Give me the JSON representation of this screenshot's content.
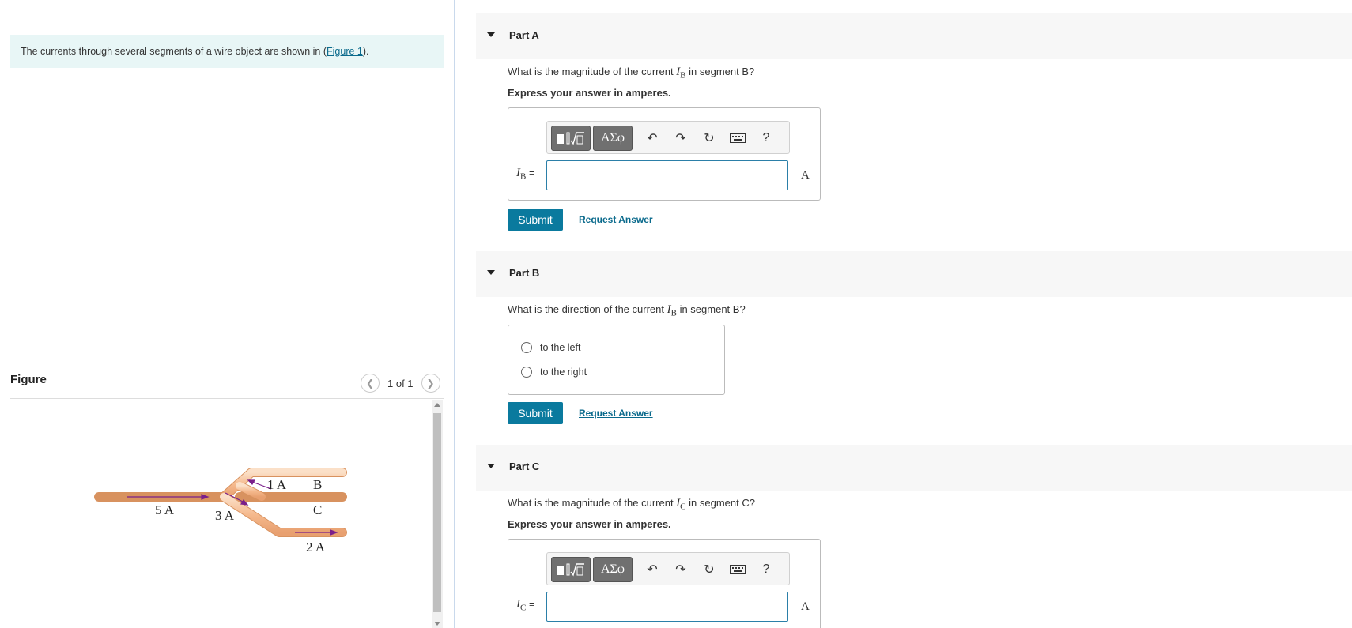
{
  "intro": {
    "text": "The currents through several segments of a wire object are shown in (",
    "link": "Figure 1",
    "after": ")."
  },
  "figure": {
    "title": "Figure",
    "count": "1 of 1",
    "labels": {
      "five_a": "5 A",
      "three_a": "3 A",
      "one_a": "1 A",
      "b": "B",
      "c": "C",
      "two_a": "2 A"
    },
    "wire_color": "#f7c9a3",
    "arrow_color": "#7a1f8a"
  },
  "parts": {
    "a": {
      "label": "Part A",
      "question_pre": "What is the magnitude of the current ",
      "symbol": "I",
      "subscript": "B",
      "question_post": " in segment B?",
      "express": "Express your answer in amperes.",
      "unit": "A",
      "eq": "=",
      "submit": "Submit",
      "request": "Request Answer"
    },
    "b": {
      "label": "Part B",
      "question_pre": "What is the direction of the current ",
      "symbol": "I",
      "subscript": "B",
      "question_post": " in segment B?",
      "options": [
        "to the left",
        "to the right"
      ],
      "submit": "Submit",
      "request": "Request Answer"
    },
    "c": {
      "label": "Part C",
      "question_pre": "What is the magnitude of the current ",
      "symbol": "I",
      "subscript": "C",
      "question_post": " in segment C?",
      "express": "Express your answer in amperes.",
      "unit": "A",
      "eq": "=",
      "submit": "Submit",
      "request": "Request Answer"
    }
  },
  "toolbar": {
    "symbols_label": "ΑΣφ",
    "help_label": "?",
    "icons": [
      "templates-icon",
      "undo-icon",
      "redo-icon",
      "reset-icon",
      "keyboard-icon"
    ]
  },
  "colors": {
    "accent": "#0a7a9e",
    "link": "#0a6a8c",
    "intro_bg": "#e8f6f6"
  }
}
